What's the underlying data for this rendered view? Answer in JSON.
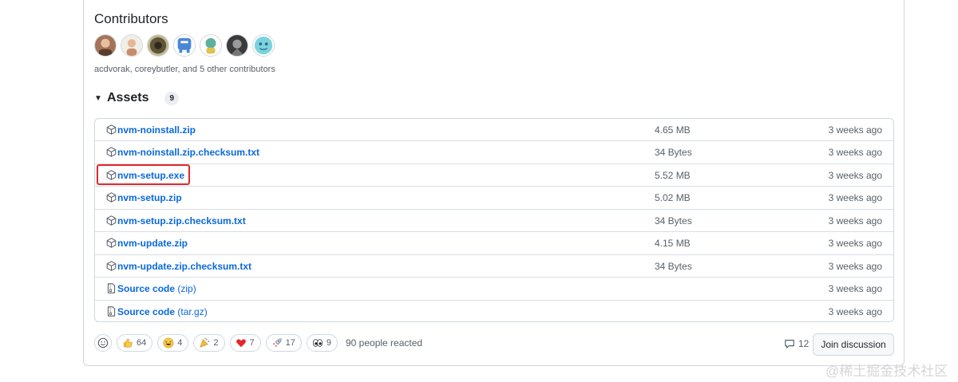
{
  "contributors": {
    "title": "Contributors",
    "summary": "acdvorak, coreybutler, and 5 other contributors",
    "avatars": [
      {
        "colors": [
          "#a4735a",
          "#5a3d2c"
        ]
      },
      {
        "colors": [
          "#f1ede7",
          "#c98b6a"
        ]
      },
      {
        "colors": [
          "#5e553a",
          "#2f2a1c"
        ]
      },
      {
        "colors": [
          "#4a86d8",
          "#ffffff"
        ]
      },
      {
        "colors": [
          "#5cb0a0",
          "#e0c24b"
        ]
      },
      {
        "colors": [
          "#3a3a3a",
          "#9a9a9a"
        ]
      },
      {
        "colors": [
          "#7ad3df",
          "#2f6f7c"
        ]
      }
    ]
  },
  "assets": {
    "title": "Assets",
    "count": "9",
    "items": [
      {
        "name": "nvm-noinstall.zip",
        "suffix": "",
        "size": "4.65 MB",
        "date": "3 weeks ago",
        "icon": "package-icon"
      },
      {
        "name": "nvm-noinstall.zip.checksum.txt",
        "suffix": "",
        "size": "34 Bytes",
        "date": "3 weeks ago",
        "icon": "package-icon"
      },
      {
        "name": "nvm-setup.exe",
        "suffix": "",
        "size": "5.52 MB",
        "date": "3 weeks ago",
        "icon": "package-icon"
      },
      {
        "name": "nvm-setup.zip",
        "suffix": "",
        "size": "5.02 MB",
        "date": "3 weeks ago",
        "icon": "package-icon"
      },
      {
        "name": "nvm-setup.zip.checksum.txt",
        "suffix": "",
        "size": "34 Bytes",
        "date": "3 weeks ago",
        "icon": "package-icon"
      },
      {
        "name": "nvm-update.zip",
        "suffix": "",
        "size": "4.15 MB",
        "date": "3 weeks ago",
        "icon": "package-icon"
      },
      {
        "name": "nvm-update.zip.checksum.txt",
        "suffix": "",
        "size": "34 Bytes",
        "date": "3 weeks ago",
        "icon": "package-icon"
      },
      {
        "name": "Source code",
        "suffix": "(zip)",
        "size": "",
        "date": "3 weeks ago",
        "icon": "file-zip-icon"
      },
      {
        "name": "Source code",
        "suffix": "(tar.gz)",
        "size": "",
        "date": "3 weeks ago",
        "icon": "file-zip-icon"
      }
    ]
  },
  "reactions": {
    "items": [
      {
        "emoji": "thumbs-up",
        "count": "64"
      },
      {
        "emoji": "laugh",
        "count": "4"
      },
      {
        "emoji": "tada",
        "count": "2"
      },
      {
        "emoji": "heart",
        "count": "7"
      },
      {
        "emoji": "rocket",
        "count": "17"
      },
      {
        "emoji": "eyes",
        "count": "9"
      }
    ],
    "summary": "90 people reacted"
  },
  "discussion": {
    "comment_count": "12",
    "join_label": "Join discussion"
  },
  "highlight_color": "#e5262a",
  "link_color": "#0969da",
  "watermark": "@稀土掘金技术社区"
}
